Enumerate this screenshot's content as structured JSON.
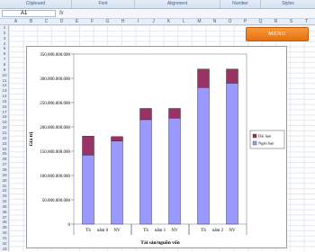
{
  "ribbon": {
    "groups": [
      "Clipboard",
      "Font",
      "Alignment",
      "Number",
      "Styles"
    ]
  },
  "formula_bar": {
    "name_box": "A1",
    "fx": "fx"
  },
  "columns": [
    "A",
    "B",
    "C",
    "D",
    "E",
    "F",
    "G",
    "H",
    "I",
    "J",
    "K",
    "L",
    "M",
    "N",
    "O",
    "P",
    "Q",
    "R",
    "S",
    "T"
  ],
  "rows": [
    "1",
    "2",
    "3",
    "4",
    "5",
    "6",
    "7",
    "8",
    "9",
    "10",
    "11",
    "12",
    "13",
    "14",
    "15",
    "16",
    "17",
    "18",
    "19",
    "20",
    "21",
    "22",
    "23",
    "24",
    "25",
    "26",
    "27",
    "28",
    "29",
    "30",
    "31",
    "32",
    "33",
    "34",
    "35",
    "36",
    "37",
    "38",
    "39",
    "40",
    "41",
    "42",
    "43"
  ],
  "menu_button": "MENU",
  "chart_data": {
    "type": "bar",
    "stacked": true,
    "categories": [
      "TS",
      "NV",
      "TS",
      "NV",
      "TS",
      "NV"
    ],
    "groups": [
      "năm 0",
      "năm 1",
      "năm 2"
    ],
    "series": [
      {
        "name": "Ngắn hạn",
        "color": "#9999ff",
        "values": [
          142000000000,
          171000000000,
          215000000000,
          218000000000,
          281000000000,
          290000000000
        ]
      },
      {
        "name": "Dài hạn",
        "color": "#993366",
        "values": [
          39000000000,
          9000000000,
          23000000000,
          20000000000,
          38000000000,
          29000000000
        ]
      }
    ],
    "ylim": [
      0,
      350000000000
    ],
    "yticks": [
      "0",
      "50.000.000.000",
      "100.000.000.000",
      "150.000.000.000",
      "200.000.000.000",
      "250.000.000.000",
      "300.000.000.000",
      "350.000.000.000"
    ],
    "ylabel": "Giá trị",
    "xlabel": "Tài sản/nguồn vốn",
    "legend_position": "right",
    "legend_order": [
      "Dài hạn",
      "Ngắn hạn"
    ]
  }
}
